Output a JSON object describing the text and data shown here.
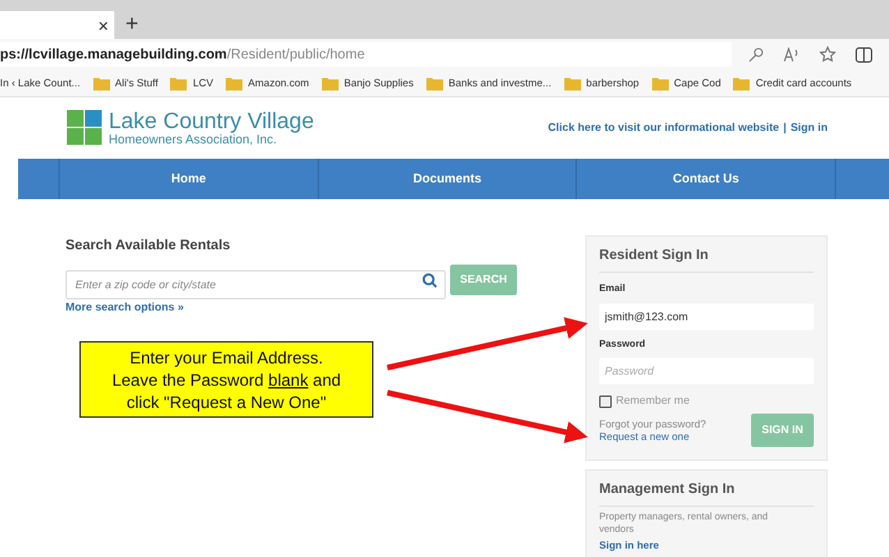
{
  "browser": {
    "tab_close": "×",
    "new_tab": "+",
    "url_host": "ps://lcvillage.managebuilding.com",
    "url_path": "/Resident/public/home",
    "bookmarks": [
      {
        "label": "In ‹ Lake Count...",
        "kind": "page"
      },
      {
        "label": "Ali's Stuff",
        "kind": "folder"
      },
      {
        "label": "LCV",
        "kind": "folder"
      },
      {
        "label": "Amazon.com",
        "kind": "folder"
      },
      {
        "label": "Banjo Supplies",
        "kind": "folder"
      },
      {
        "label": "Banks and investme...",
        "kind": "folder"
      },
      {
        "label": "barbershop",
        "kind": "folder"
      },
      {
        "label": "Cape Cod",
        "kind": "folder"
      },
      {
        "label": "Credit card accounts",
        "kind": "folder"
      }
    ]
  },
  "header": {
    "logo_title": "Lake Country Village",
    "logo_subtitle": "Homeowners Association, Inc.",
    "info_link": "Click here to visit our informational website",
    "separator": "|",
    "sign_in_link": "Sign in"
  },
  "nav": [
    "Home",
    "Documents",
    "Contact Us"
  ],
  "search": {
    "title": "Search Available Rentals",
    "placeholder": "Enter a zip code or city/state",
    "button": "SEARCH",
    "more_link": "More search options »"
  },
  "callout": {
    "line_1": "Enter your Email Address.",
    "line_2_before": "Leave the Password ",
    "line_2_underlined": "blank",
    "line_2_after": " and",
    "line_3": "click \"Request a New One\""
  },
  "resident_sign_in": {
    "title": "Resident Sign In",
    "email_label": "Email",
    "email_value": "jsmith@123.com",
    "password_label": "Password",
    "password_placeholder": "Password",
    "remember_label": "Remember me",
    "remember_checked": false,
    "forgot_text": "Forgot your password?",
    "request_link": "Request a new one",
    "button": "SIGN IN"
  },
  "management_sign_in": {
    "title": "Management Sign In",
    "text": "Property managers, rental owners, and vendors",
    "link": "Sign in here"
  }
}
